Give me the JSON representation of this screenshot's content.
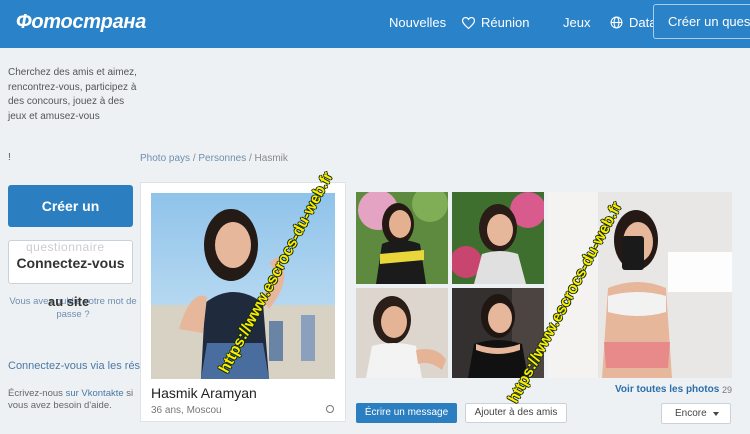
{
  "header": {
    "logo": "Фотострана",
    "nav": {
      "news": "Nouvelles",
      "meet": "Réunion",
      "games": "Jeux",
      "dating": "Datation"
    },
    "create_account": "Créer un questi"
  },
  "sidebar": {
    "intro": "Cherchez des amis et aimez, rencontrez-vous, participez à des concours, jouez à des jeux et amusez-vous",
    "exclamation": "!",
    "create_button": "Créer un",
    "ghost_text": "questionnaire",
    "login_button": "Connectez-vous",
    "forgot_text": "Vous avez oublié votre mot de passe ?",
    "au_site": "au site",
    "social_login": "Connectez-vous via les réseaux soc",
    "help_prefix": "Écrivez-nous ",
    "help_link": "sur Vkontakte",
    "help_suffix": " si vous avez besoin d'aide."
  },
  "breadcrumb": {
    "item1": "Photo pays",
    "sep": " / ",
    "item2": "Personnes",
    "current": "Hasmik"
  },
  "profile": {
    "name": "Hasmik Aramyan",
    "meta": "36 ans, Moscou"
  },
  "photos": {
    "see_all": "Voir toutes les photos",
    "count": "29"
  },
  "actions": {
    "write": "Écrire un message",
    "add_friend": "Ajouter à des amis",
    "more": "Encore"
  },
  "watermark": {
    "text1": "https://www.escrocs-du-web.fr",
    "text2": "https://www.escrocs-du-web.fr"
  },
  "colors": {
    "header_bg": "#2a82c8",
    "primary_button": "#2b7fc0",
    "link": "#4a79a5",
    "watermark": "#ffea00"
  }
}
